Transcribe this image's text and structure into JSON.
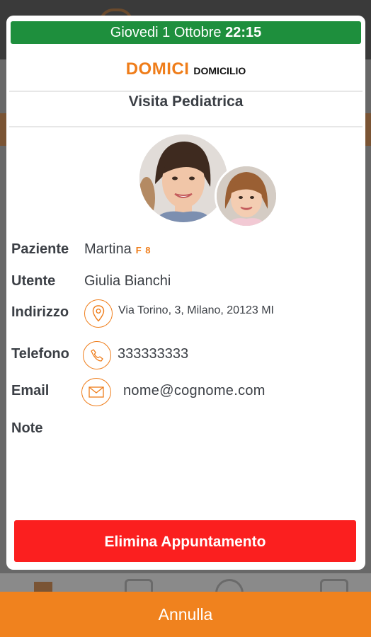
{
  "colors": {
    "accent": "#ef7d1a",
    "date_bar": "#1e8f3d",
    "danger": "#fb1f1f",
    "cancel_bar": "#f0821e",
    "text": "#3b3f45"
  },
  "header": {
    "date": "Giovedi 1 Ottobre",
    "time": "22:15"
  },
  "title": {
    "brand": "DOMICI",
    "type": "DOMICILIO"
  },
  "visit": {
    "name": "Visita Pediatrica"
  },
  "details": {
    "patient_label": "Paziente",
    "patient_value": "Martina",
    "patient_tag": "F 8",
    "user_label": "Utente",
    "user_value": "Giulia Bianchi",
    "address_label": "Indirizzo",
    "address_value": "Via Torino, 3, Milano, 20123 MI",
    "address_icon": "location-pin-icon",
    "phone_label": "Telefono",
    "phone_value": "333333333",
    "phone_icon": "phone-icon",
    "email_label": "Email",
    "email_value": "nome@cognome.com",
    "email_icon": "mail-icon",
    "note_label": "Note"
  },
  "actions": {
    "delete_label": "Elimina Appuntamento",
    "cancel_label": "Annulla"
  }
}
